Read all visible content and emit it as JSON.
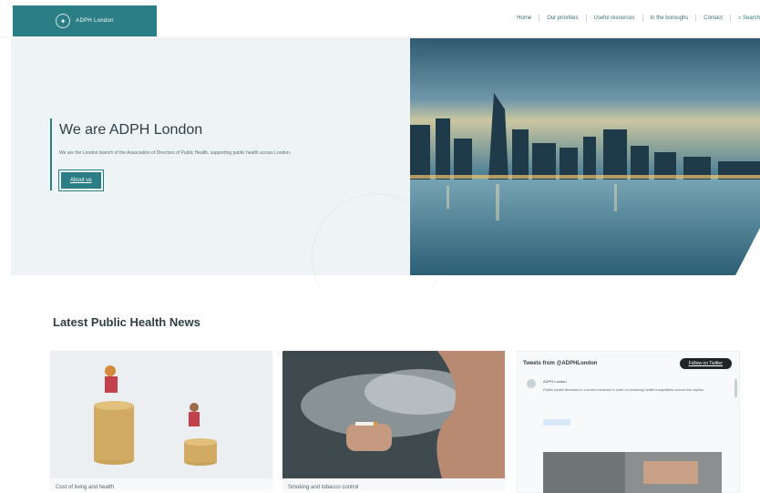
{
  "header": {
    "logo_text": "ADPH London",
    "nav": [
      "Home",
      "Our priorities",
      "Useful resources",
      "In the boroughs",
      "Contact"
    ],
    "search_label": "Search"
  },
  "hero": {
    "title": "We are ADPH London",
    "subtitle": "We are the London branch of the Association of Directors of Public Health, supporting public health across London.",
    "button_label": "About us"
  },
  "news": {
    "heading": "Latest Public Health News",
    "cards": [
      {
        "caption": "Cost of living and health"
      },
      {
        "caption": "Smoking and tobacco control"
      }
    ]
  },
  "tweets": {
    "heading": "Tweets from @ADPHLondon",
    "follow_label": "Follow on Twitter",
    "author": "ADPH London",
    "text": "Public health directors in London continue to work on reducing health inequalities across the capital."
  },
  "colors": {
    "accent": "#2b7d86",
    "hero_bg": "#eef4f6"
  }
}
